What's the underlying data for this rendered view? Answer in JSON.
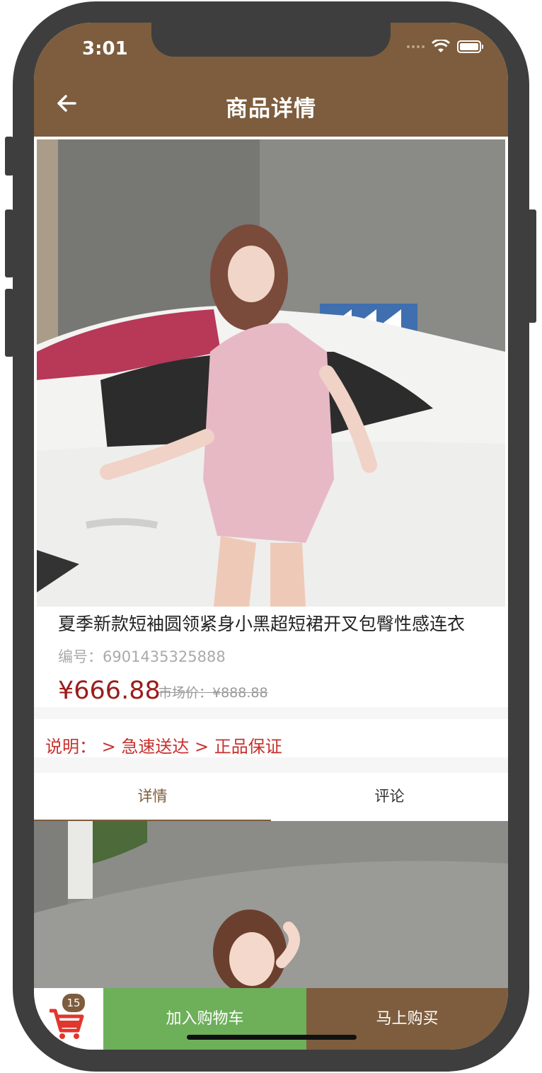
{
  "status_bar": {
    "time": "3:01"
  },
  "nav": {
    "title": "商品详情"
  },
  "product": {
    "title": "夏季新款短袖圆领紧身小黑超短裙开叉包臀性感连衣",
    "code": "编号：6901435325888",
    "price": "¥666.88",
    "market_price": "市场价：¥888.88"
  },
  "description": "说明：  > 急速送达 > 正品保证",
  "tabs": [
    {
      "label": "详情",
      "active": true
    },
    {
      "label": "评论",
      "active": false
    }
  ],
  "bottom_bar": {
    "cart_count": "15",
    "add_to_cart": "加入购物车",
    "buy_now": "马上购买"
  },
  "colors": {
    "brand": "#7d5d3d",
    "price": "#9b1c1c",
    "description": "#c6312d",
    "add_to_cart": "#6eaf5a"
  }
}
